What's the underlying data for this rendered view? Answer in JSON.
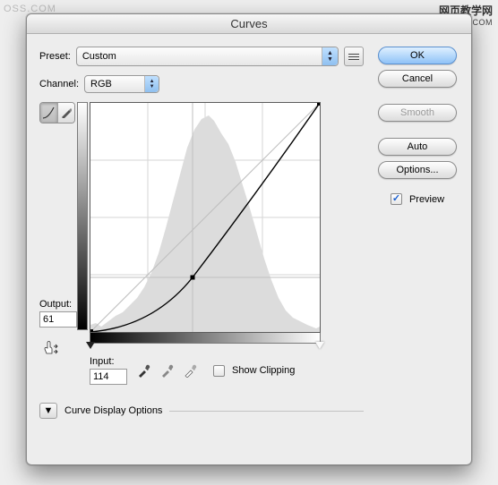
{
  "title": "Curves",
  "preset": {
    "label": "Preset:",
    "value": "Custom"
  },
  "channel": {
    "label": "Channel:",
    "value": "RGB"
  },
  "io": {
    "output_label": "Output:",
    "output_value": "61",
    "input_label": "Input:",
    "input_value": "114"
  },
  "show_clipping": "Show Clipping",
  "curve_display_options": "Curve Display Options",
  "buttons": {
    "ok": "OK",
    "cancel": "Cancel",
    "smooth": "Smooth",
    "auto": "Auto",
    "options": "Options..."
  },
  "preview": "Preview",
  "watermarks": {
    "tl": "OSS.COM",
    "tr1": "网页教学网",
    "tr2": "WWW.WEBJX.COM"
  },
  "chart_data": {
    "type": "line",
    "title": "Curves",
    "xlabel": "Input",
    "ylabel": "Output",
    "xlim": [
      0,
      255
    ],
    "ylim": [
      0,
      255
    ],
    "series": [
      {
        "name": "baseline",
        "x": [
          0,
          255
        ],
        "y": [
          0,
          255
        ]
      },
      {
        "name": "curve",
        "x": [
          0,
          114,
          255
        ],
        "y": [
          0,
          61,
          255
        ]
      }
    ],
    "selected_point": {
      "input": 114,
      "output": 61
    },
    "grid": true
  }
}
